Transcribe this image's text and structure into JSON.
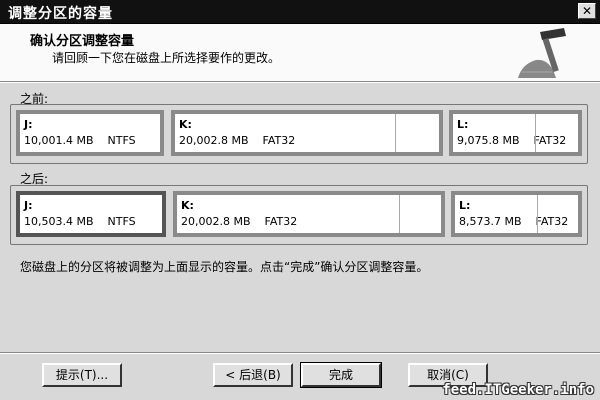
{
  "window": {
    "title": "调整分区的容量",
    "close_label": "✕"
  },
  "header": {
    "title": "确认分区调整容量",
    "subtitle": "请回顾一下您在磁盘上所选择要作的更改。",
    "icon": "hammer-icon"
  },
  "before": {
    "label": "之前:",
    "partitions": [
      {
        "drive": "J:",
        "size": "10,001.4 MB",
        "fs": "NTFS"
      },
      {
        "drive": "K:",
        "size": "20,002.8 MB",
        "fs": "FAT32"
      },
      {
        "drive": "L:",
        "size": "9,075.8 MB",
        "fs": "FAT32"
      }
    ]
  },
  "after": {
    "label": "之后:",
    "partitions": [
      {
        "drive": "J:",
        "size": "10,503.4 MB",
        "fs": "NTFS"
      },
      {
        "drive": "K:",
        "size": "20,002.8 MB",
        "fs": "FAT32"
      },
      {
        "drive": "L:",
        "size": "8,573.7 MB",
        "fs": "FAT32"
      }
    ]
  },
  "message": "您磁盘上的分区将被调整为上面显示的容量。点击“完成”确认分区调整容量。",
  "buttons": {
    "hint": "提示(T)...",
    "back": "< 后退(B)",
    "finish": "完成",
    "cancel": "取消(C)"
  },
  "watermark": "feed.ITGeeker.info"
}
